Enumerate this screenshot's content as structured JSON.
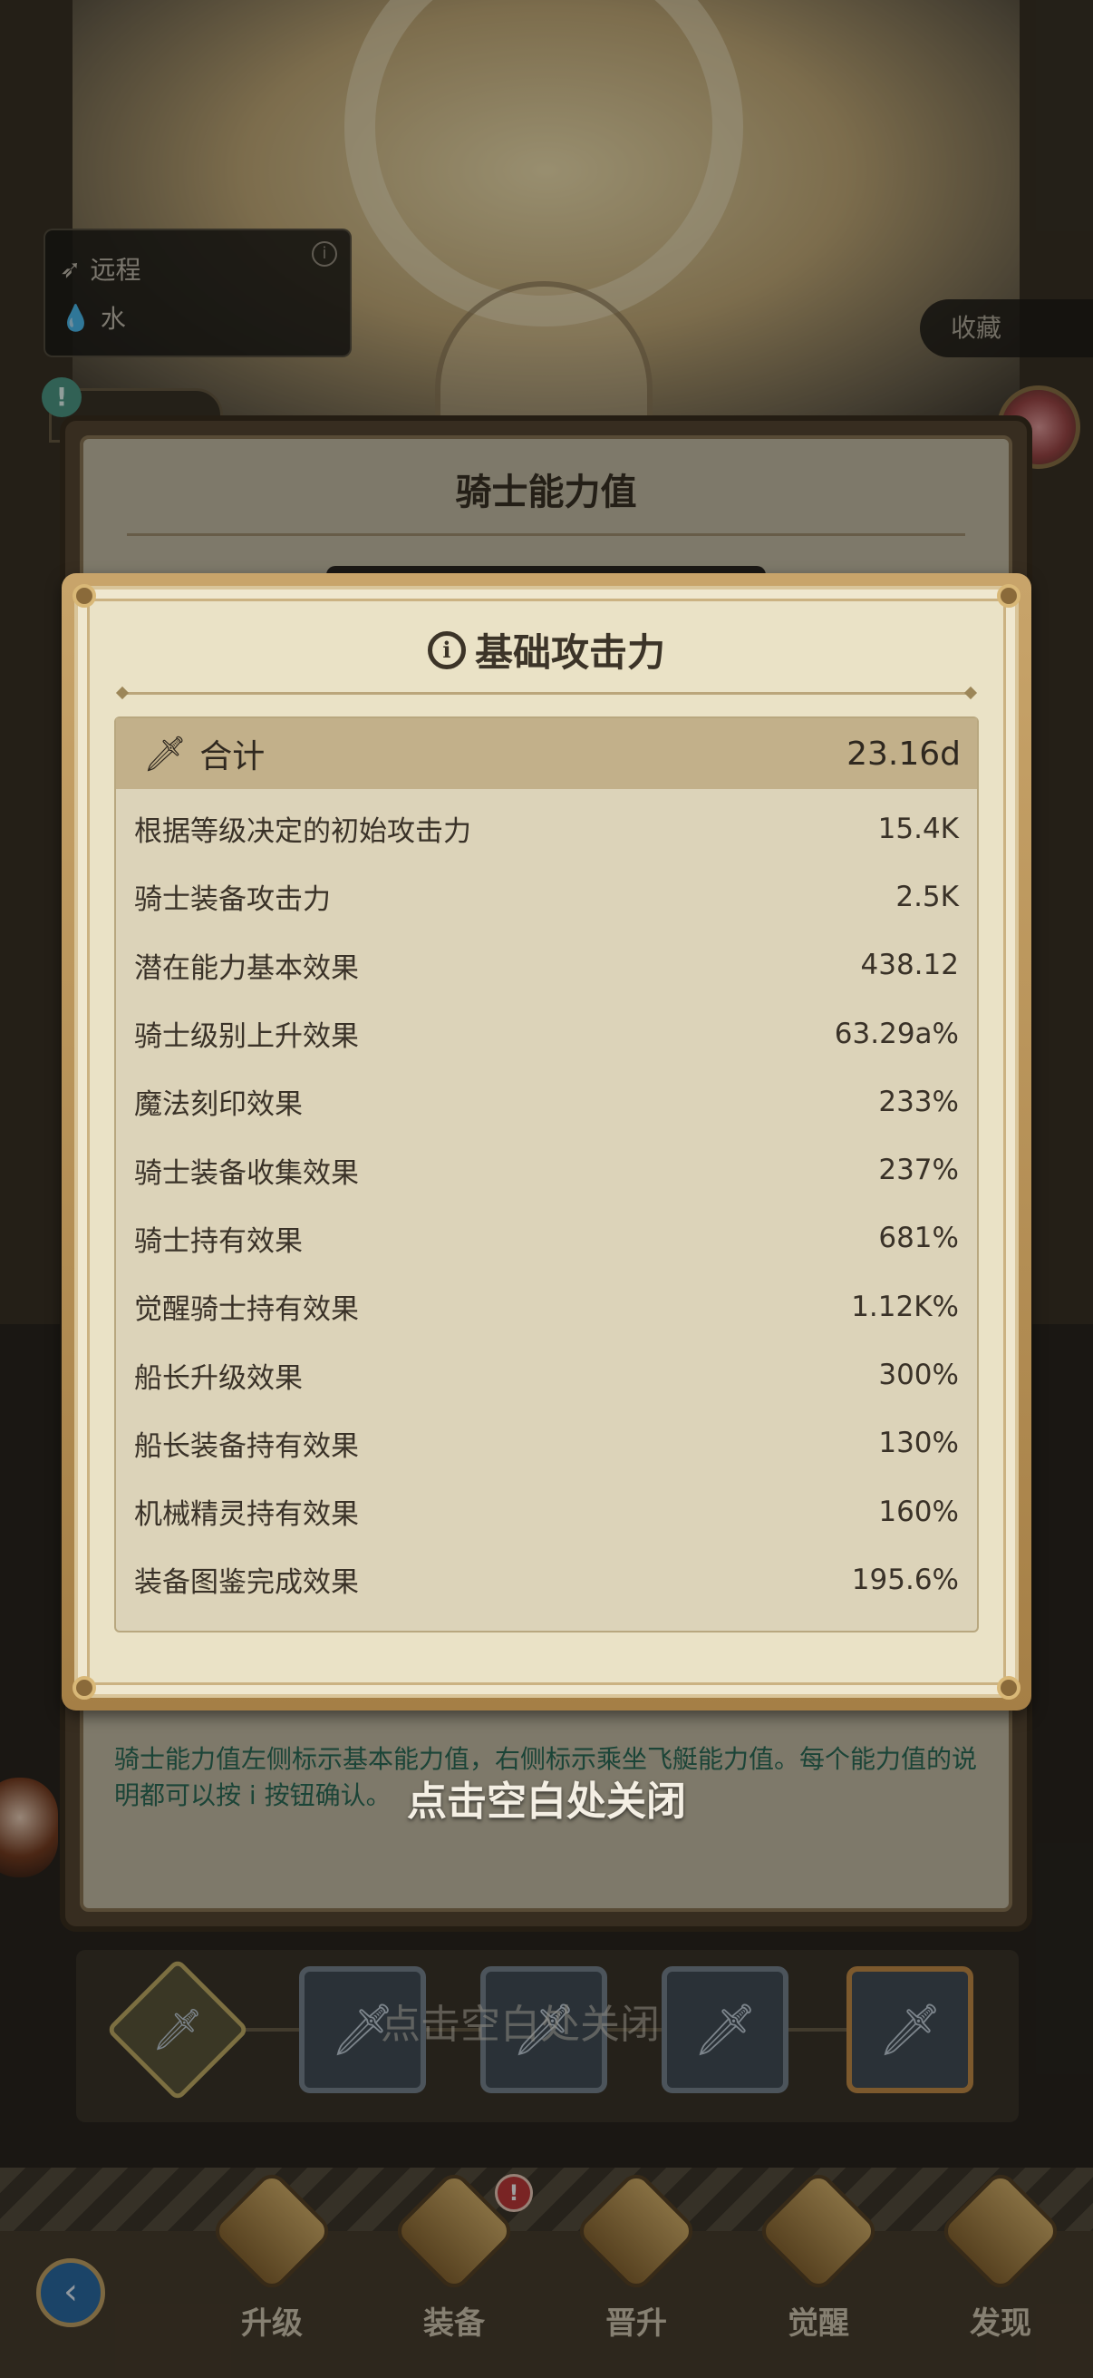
{
  "hero": {
    "type_card": {
      "attack_type": "远程",
      "element": "水",
      "info_glyph": "i"
    },
    "favorite_label": "收藏",
    "alert_glyph": "!"
  },
  "panel": {
    "title": "骑士能力值",
    "description": "骑士能力值左侧标示基本能力值，右侧标示乘坐飞艇能力值。每个能力值的说明都可以按 i 按钮确认。",
    "ghost_close": "点击空白处关闭"
  },
  "modal": {
    "title": "基础攻击力",
    "info_glyph": "i",
    "total": {
      "label": "合计",
      "value": "23.16d",
      "icon": "sword-icon"
    },
    "rows": [
      {
        "label": "根据等级决定的初始攻击力",
        "value": "15.4K"
      },
      {
        "label": "骑士装备攻击力",
        "value": "2.5K"
      },
      {
        "label": "潜在能力基本效果",
        "value": "438.12"
      },
      {
        "label": "骑士级别上升效果",
        "value": "63.29a%"
      },
      {
        "label": "魔法刻印效果",
        "value": "233%"
      },
      {
        "label": "骑士装备收集效果",
        "value": "237%"
      },
      {
        "label": "骑士持有效果",
        "value": "681%"
      },
      {
        "label": "觉醒骑士持有效果",
        "value": "1.12K%"
      },
      {
        "label": "船长升级效果",
        "value": "300%"
      },
      {
        "label": "船长装备持有效果",
        "value": "130%"
      },
      {
        "label": "机械精灵持有效果",
        "value": "160%"
      },
      {
        "label": "装备图鉴完成效果",
        "value": "195.6%"
      }
    ]
  },
  "close_hint": "点击空白处关闭",
  "nav": {
    "items": [
      {
        "label": "升级",
        "icon": "level-up-icon"
      },
      {
        "label": "装备",
        "icon": "shield-icon"
      },
      {
        "label": "晋升",
        "icon": "star-icon"
      },
      {
        "label": "觉醒",
        "icon": "sparkle-icon"
      },
      {
        "label": "发现",
        "icon": "discover-icon"
      }
    ],
    "alert_glyph": "!",
    "back_glyph": "‹"
  },
  "colors": {
    "accent_gold": "#c8a46a",
    "panel_cream": "#eae2c6",
    "desc_teal": "#2d6f5a"
  }
}
